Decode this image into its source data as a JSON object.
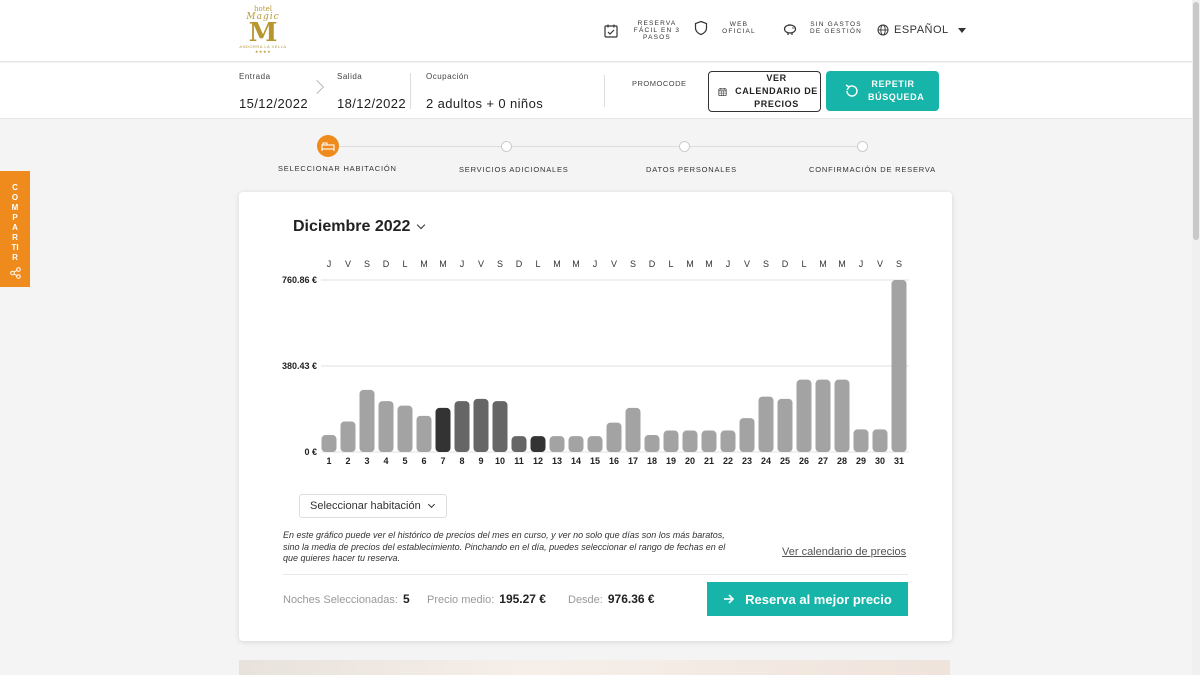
{
  "header": {
    "logo": {
      "small": "hotel",
      "big": "Magic",
      "mark": "M",
      "tagline": "ANDORRA LA VELLA",
      "stars": "★★★★"
    },
    "features": [
      {
        "icon": "calendar-check-icon",
        "label": "RESERVA FÁCIL EN 3 PASOS"
      },
      {
        "icon": "shield-icon",
        "label": "WEB OFICIAL"
      },
      {
        "icon": "piggy-bank-icon",
        "label": "SIN GASTOS DE GESTIÓN"
      }
    ],
    "language": "ESPAÑOL"
  },
  "search": {
    "checkin_label": "Entrada",
    "checkin_value": "15/12/2022",
    "checkout_label": "Salida",
    "checkout_value": "18/12/2022",
    "occupancy_label": "Ocupación",
    "occupancy_value": "2 adultos + 0 niños",
    "promocode_label": "PROMOCODE",
    "calendar_button": "VER CALENDARIO DE PRECIOS",
    "repeat_button": "REPETIR BÚSQUEDA"
  },
  "steps": [
    {
      "label": "SELECCIONAR HABITACIÓN",
      "active": true
    },
    {
      "label": "SERVICIOS ADICIONALES",
      "active": false
    },
    {
      "label": "DATOS PERSONALES",
      "active": false
    },
    {
      "label": "CONFIRMACIÓN DE RESERVA",
      "active": false
    }
  ],
  "share_tab": "COMPARTIR",
  "card": {
    "month_label": "Diciembre 2022",
    "select_room": "Seleccionar habitación",
    "description": "En este gráfico puede ver el histórico de precios del mes en curso, y ver no solo que días son los más baratos, sino la media de precios del establecimiento. Pinchando en el día, puedes seleccionar el rango de fechas en el que quieres hacer tu reserva.",
    "calendar_link": "Ver calendario de precios",
    "nights_label": "Noches Seleccionadas:",
    "nights_value": "5",
    "avg_label": "Precio medio:",
    "avg_value": "195.27 €",
    "from_label": "Desde:",
    "from_value": "976.36 €",
    "book_button": "Reserva al mejor precio"
  },
  "chart_data": {
    "type": "bar",
    "title": "",
    "xlabel": "",
    "ylabel": "",
    "ylim": [
      0,
      760.86
    ],
    "ytick_labels": [
      "760.86 €",
      "380.43 €",
      "0 €"
    ],
    "yticks": [
      760.86,
      380.43,
      0
    ],
    "weekdays": [
      "J",
      "V",
      "S",
      "D",
      "L",
      "M",
      "M",
      "J",
      "V",
      "S",
      "D",
      "L",
      "M",
      "M",
      "J",
      "V",
      "S",
      "D",
      "L",
      "M",
      "M",
      "J",
      "V",
      "S",
      "D",
      "L",
      "M",
      "M",
      "J",
      "V",
      "S"
    ],
    "categories": [
      "1",
      "2",
      "3",
      "4",
      "5",
      "6",
      "7",
      "8",
      "9",
      "10",
      "11",
      "12",
      "13",
      "14",
      "15",
      "16",
      "17",
      "18",
      "19",
      "20",
      "21",
      "22",
      "23",
      "24",
      "25",
      "26",
      "27",
      "28",
      "29",
      "30",
      "31"
    ],
    "values": [
      75,
      135,
      275,
      225,
      205,
      160,
      195,
      225,
      235,
      225,
      70,
      70,
      70,
      70,
      70,
      130,
      195,
      75,
      95,
      95,
      95,
      95,
      150,
      245,
      235,
      320,
      320,
      320,
      100,
      100,
      760.86
    ],
    "selected_days": [
      "7",
      "8",
      "9",
      "10",
      "11",
      "12"
    ],
    "colors": {
      "normal": "#a3a3a3",
      "selected_dark": "#333333",
      "selected_mid": "#666666",
      "grid": "#e0e0e0"
    },
    "grid": true
  },
  "colors": {
    "accent_teal": "#17b5a9",
    "accent_orange": "#ee8b1c",
    "logo_gold": "#b8962e"
  }
}
